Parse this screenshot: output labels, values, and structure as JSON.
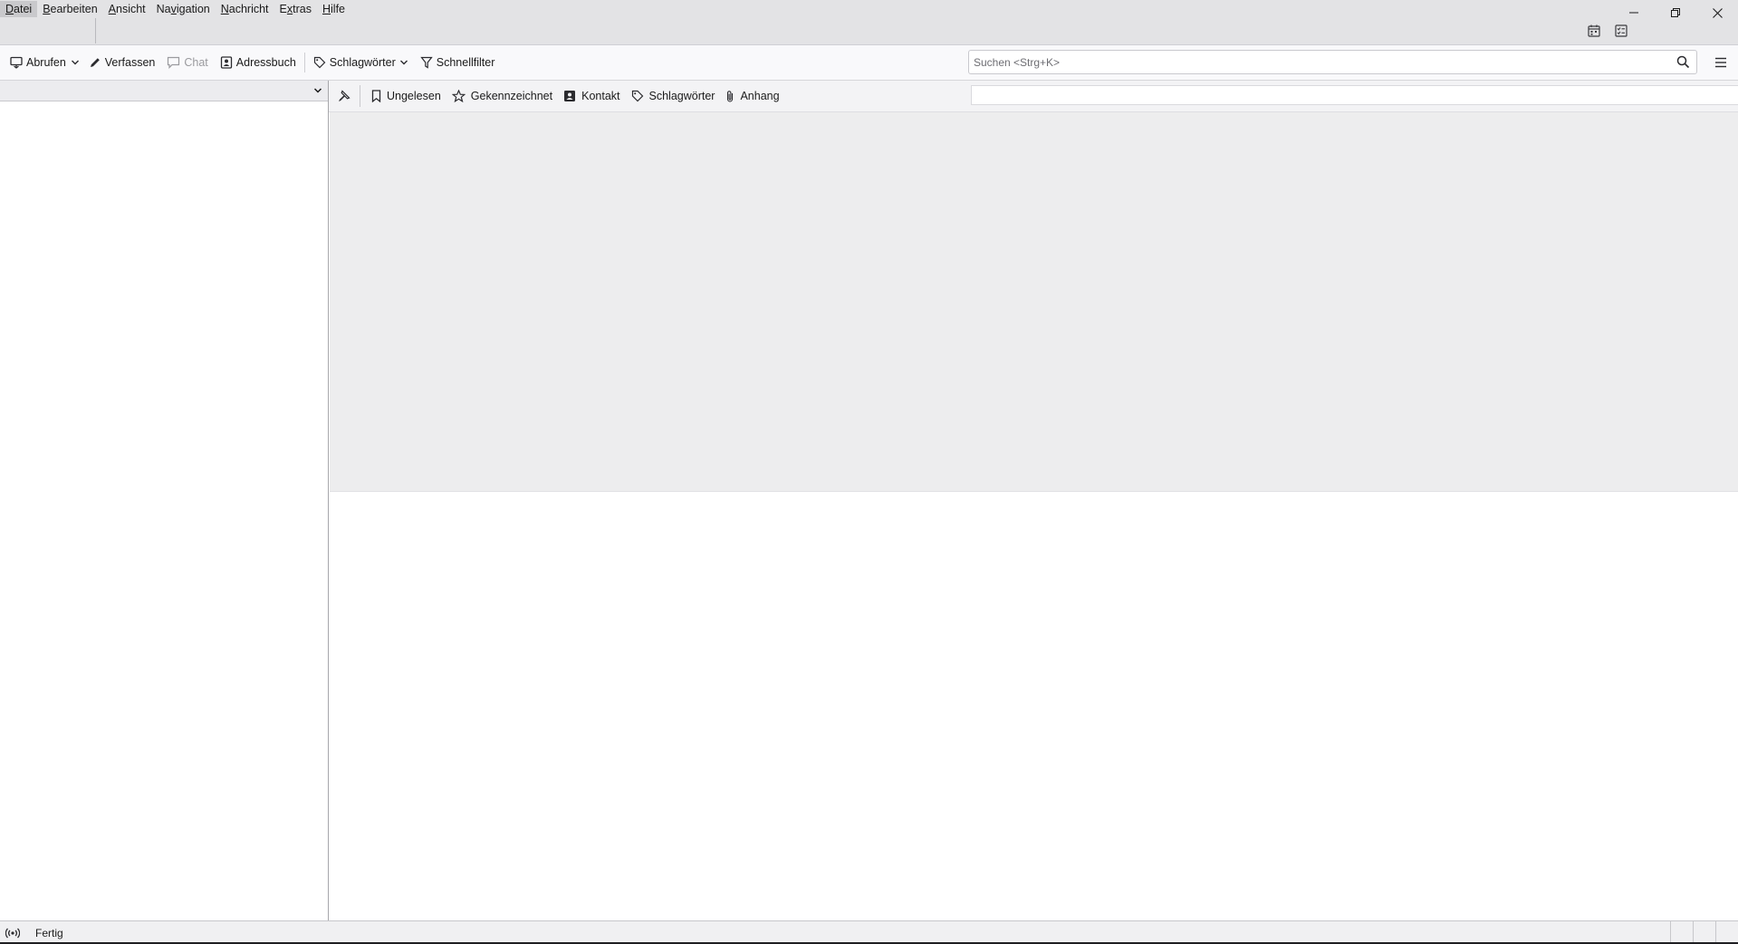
{
  "menubar": {
    "items": [
      {
        "pre": "",
        "acc": "D",
        "post": "atei"
      },
      {
        "pre": "",
        "acc": "B",
        "post": "earbeiten"
      },
      {
        "pre": "",
        "acc": "A",
        "post": "nsicht"
      },
      {
        "pre": "Na",
        "acc": "v",
        "post": "igation"
      },
      {
        "pre": "",
        "acc": "N",
        "post": "achricht"
      },
      {
        "pre": "E",
        "acc": "x",
        "post": "tras"
      },
      {
        "pre": "",
        "acc": "H",
        "post": "ilfe"
      }
    ],
    "active_index": 0
  },
  "spaces": {
    "calendar_icon": "calendar-icon",
    "tasks_icon": "tasks-icon"
  },
  "toolbar": {
    "get_messages_label": "Abrufen",
    "write_label": "Verfassen",
    "chat_label": "Chat",
    "address_book_label": "Adressbuch",
    "tag_label": "Schlagwörter",
    "quick_filter_label": "Schnellfilter"
  },
  "search": {
    "placeholder": "Suchen <Strg+K>"
  },
  "quick_filter": {
    "unread_label": "Ungelesen",
    "starred_label": "Gekennzeichnet",
    "contact_label": "Kontakt",
    "tags_label": "Schlagwörter",
    "attachment_label": "Anhang",
    "filter_value": ""
  },
  "folder_pane": {
    "selected_folder": ""
  },
  "status": {
    "text": "Fertig"
  },
  "colors": {
    "titlebar_bg": "#e3e3e5",
    "toolbar_bg": "#f9f9fb",
    "thread_pane_bg": "#ededee",
    "status_bg": "#f0f0f2"
  }
}
